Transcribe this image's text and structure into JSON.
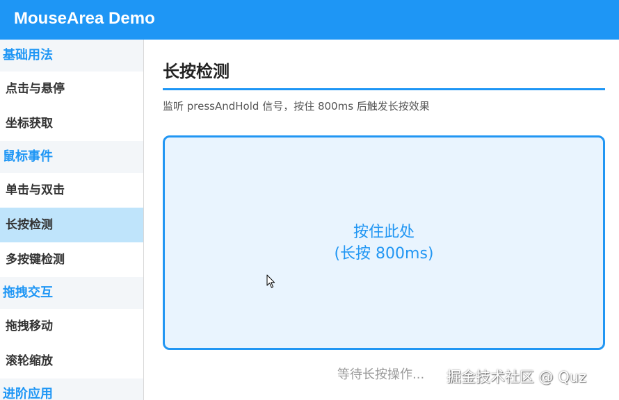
{
  "app": {
    "title": "MouseArea Demo"
  },
  "sidebar": {
    "groups": [
      {
        "label": "基础用法",
        "items": [
          "点击与悬停",
          "坐标获取"
        ]
      },
      {
        "label": "鼠标事件",
        "items": [
          "单击与双击",
          "长按检测",
          "多按键检测"
        ]
      },
      {
        "label": "拖拽交互",
        "items": [
          "拖拽移动",
          "滚轮缩放"
        ]
      },
      {
        "label": "进阶应用",
        "items": []
      }
    ],
    "active_item": "长按检测"
  },
  "main": {
    "title": "长按检测",
    "subtitle": "监听 pressAndHold 信号，按住 800ms 后触发长按效果",
    "press_area": {
      "line1": "按住此处",
      "line2": "(长按 800ms)"
    },
    "status": "等待长按操作...",
    "watermark": "掘金技术社区 @ Quz"
  },
  "colors": {
    "accent": "#1e96f5",
    "active_item_bg": "#bfe4fb",
    "press_area_bg": "#e9f4fe",
    "group_header_bg": "#f3f6f9"
  }
}
